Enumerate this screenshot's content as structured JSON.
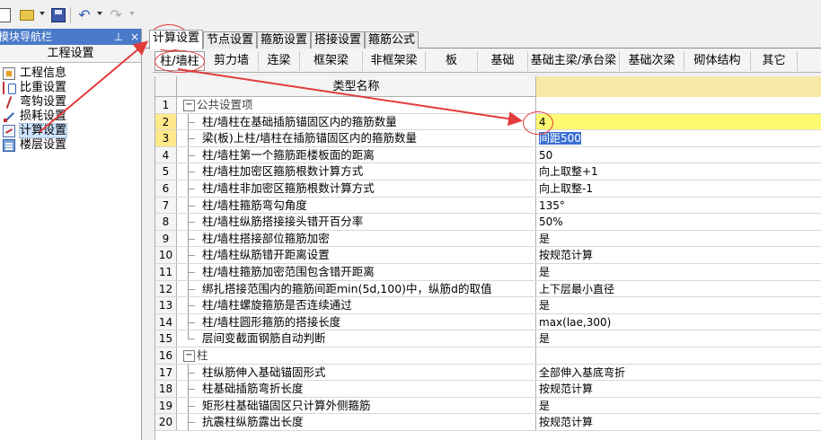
{
  "toolbar": {
    "items": [
      "new-icon",
      "open-folder-icon",
      "save-icon",
      "undo-icon",
      "redo-icon"
    ]
  },
  "left_panel": {
    "title": "模块导航栏",
    "pin": "1",
    "close": "×",
    "header": "工程设置",
    "items": [
      {
        "label": "工程信息",
        "icon": "info-icon"
      },
      {
        "label": "比重设置",
        "icon": "ratio-icon"
      },
      {
        "label": "弯钩设置",
        "icon": "hook-icon"
      },
      {
        "label": "损耗设置",
        "icon": "loss-icon"
      },
      {
        "label": "计算设置",
        "icon": "calc-icon",
        "selected": true
      },
      {
        "label": "楼层设置",
        "icon": "floor-icon"
      }
    ]
  },
  "main_tabs": [
    "计算设置",
    "节点设置",
    "箍筋设置",
    "搭接设置",
    "箍筋公式"
  ],
  "sub_tabs": [
    "柱/墙柱",
    "剪力墙",
    "连梁",
    "框架梁",
    "非框架梁",
    "板",
    "基础",
    "基础主梁/承台梁",
    "基础次梁",
    "砌体结构",
    "其它"
  ],
  "grid": {
    "header_name": "类型名称",
    "rows": [
      {
        "num": "1",
        "name": "公共设置项",
        "value": "",
        "group": true
      },
      {
        "num": "2",
        "name": "柱/墙柱在基础插筋锚固区内的箍筋数量",
        "value": "4"
      },
      {
        "num": "3",
        "name": "梁(板)上柱/墙柱在插筋锚固区内的箍筋数量",
        "value": "间距500"
      },
      {
        "num": "4",
        "name": "柱/墙柱第一个箍筋距楼板面的距离",
        "value": "50"
      },
      {
        "num": "5",
        "name": "柱/墙柱加密区箍筋根数计算方式",
        "value": "向上取整+1"
      },
      {
        "num": "6",
        "name": "柱/墙柱非加密区箍筋根数计算方式",
        "value": "向上取整-1"
      },
      {
        "num": "7",
        "name": "柱/墙柱箍筋弯勾角度",
        "value": "135°"
      },
      {
        "num": "8",
        "name": "柱/墙柱纵筋搭接接头错开百分率",
        "value": "50%"
      },
      {
        "num": "9",
        "name": "柱/墙柱搭接部位箍筋加密",
        "value": "是"
      },
      {
        "num": "10",
        "name": "柱/墙柱纵筋错开距离设置",
        "value": "按规范计算"
      },
      {
        "num": "11",
        "name": "柱/墙柱箍筋加密范围包含错开距离",
        "value": "是"
      },
      {
        "num": "12",
        "name": "绑扎搭接范围内的箍筋间距min(5d,100)中，纵筋d的取值",
        "value": "上下层最小直径"
      },
      {
        "num": "13",
        "name": "柱/墙柱螺旋箍筋是否连续通过",
        "value": "是"
      },
      {
        "num": "14",
        "name": "柱/墙柱圆形箍筋的搭接长度",
        "value": "max(lae,300)"
      },
      {
        "num": "15",
        "name": "层间变截面钢筋自动判断",
        "value": "是"
      },
      {
        "num": "16",
        "name": "柱",
        "value": "",
        "group": true
      },
      {
        "num": "17",
        "name": "柱纵筋伸入基础锚固形式",
        "value": "全部伸入基底弯折"
      },
      {
        "num": "18",
        "name": "柱基础插筋弯折长度",
        "value": "按规范计算"
      },
      {
        "num": "19",
        "name": "矩形柱基础锚固区只计算外侧箍筋",
        "value": "是"
      },
      {
        "num": "20",
        "name": "抗震柱纵筋露出长度",
        "value": "按规范计算"
      }
    ]
  },
  "annotation_color": "#e23b3b"
}
